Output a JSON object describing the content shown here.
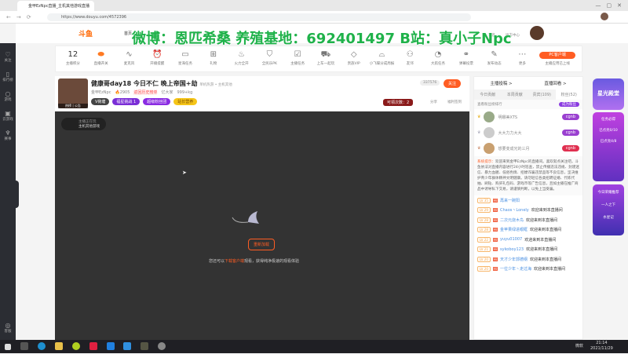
{
  "browser": {
    "tab_title": "金甲EzNpc直播_主机其他游戏直播",
    "url": "https://www.douyu.com/4572396"
  },
  "header": {
    "logo": "斗鱼",
    "nav": [
      "首页",
      "分类"
    ],
    "right": [
      "消息",
      "地方中心"
    ]
  },
  "watermark": "微博：恩匹希桑 养殖基地：692401497 B站：真小子Npc",
  "sidebar": [
    "关注",
    "排行榜",
    "游戏",
    "云游戏",
    "赛事",
    "客服"
  ],
  "toolbar": {
    "score": "12",
    "score_label": "主播积分",
    "items": [
      "直播开关",
      "麦克风",
      "开播提醒",
      "星海任务",
      "礼物",
      "火力全开",
      "全民乐PK",
      "主播任务",
      "上车一起玩",
      "贵族VIP",
      "小飞碟分成周报",
      "友邻",
      "大航任务",
      "弹幕投票",
      "发布动态",
      "更多"
    ],
    "pc_button": "PC客户端",
    "pc_sub": "主播应用已上线"
  },
  "room": {
    "title": "健康哥day18 今日不仁 晚上帝国+劫",
    "category": "单机热游 • 主机其他",
    "anchor": "金甲EzNpc",
    "hot": "2905",
    "rank_tag": "返回历史榜单",
    "fans_label": "亿大家",
    "gift": "999+kg",
    "tags": [
      "V荷塘",
      "福星挑战 1",
      "超级粉丝团",
      "站长营养"
    ],
    "follow_count": "337576",
    "follow": "关注",
    "lottery": "可领次数：2",
    "share": "分享",
    "sign": "福利签到",
    "notice": "热榜 | 公告"
  },
  "video": {
    "anchor_status": "主播正在玩",
    "game": "主机其他游戏",
    "reload": "重新加载",
    "hint_pre": "您还可以",
    "hint_link": "下载客户端",
    "hint_post": "观看，获得纯净极速的观看体验"
  },
  "panel": {
    "top_links": [
      "主播投稿 >",
      "直播回看 >"
    ],
    "tabs": [
      "今日贡献",
      "本周贡献",
      "贵宾(109)",
      "粉丝(52)"
    ],
    "fan_rank_label": "查看粉丝榜排行",
    "join": "成为粉丝",
    "ranks": [
      {
        "name": "明娜美XTS",
        "badge": "cgnb"
      },
      {
        "name": "大大力力大大",
        "badge": "cgnb"
      },
      {
        "name": "想要变成光的三月",
        "badge": "cgnb"
      }
    ],
    "system_label": "系统提示：",
    "system_msg": "欢迎来到金甲EzNpc的直播间。喜欢就点关注吧。斗鱼依法对直播内容进行24小时巡查，禁止传播违法违规、封建迷信、暴力血腥、低俗色情、招嫖诈骗违禁品等不良信息，坚决维护青少年群体精神文明健康。请勿轻信各类招聘征婚、代练代抽、刷钻、购买礼包码、游戏币等广告信息，且如主播在推广商品中诱导私下交易，请谨慎判断，以免上当受骗。",
    "messages": [
      {
        "lv": "LV 35",
        "user": "再来一碗阳",
        "text": ""
      },
      {
        "lv": "LV 29",
        "user": "Chaos丶Lonely",
        "text": "欢迎来到本直播间"
      },
      {
        "lv": "LV 28",
        "user": "二次元烧木鸟",
        "text": "欢迎来到本直播间"
      },
      {
        "lv": "LV 28",
        "user": "金苹果绿进眼眶",
        "text": "欢迎来到本直播间"
      },
      {
        "lv": "LV 22",
        "user": "yuyu01007",
        "text": "欢迎来到本直播间"
      },
      {
        "lv": "LV 21",
        "user": "sykoboy123",
        "text": "欢迎来到本直播间"
      },
      {
        "lv": "LV 20",
        "user": "天才少年郭德纲",
        "text": "欢迎来到本直播间"
      },
      {
        "lv": "LV 20",
        "user": "一位少年丶走过海",
        "text": "欢迎来到本直播间"
      }
    ]
  },
  "ads": {
    "title": "星光殿堂",
    "items": [
      "任务必得",
      "已点亮0/10",
      "已点亮4/8",
      "今日荣耀推荐",
      "一人之下",
      "水星记"
    ]
  },
  "taskbar": {
    "lang": "微软",
    "time": "21:14",
    "date": "2021/11/29"
  }
}
